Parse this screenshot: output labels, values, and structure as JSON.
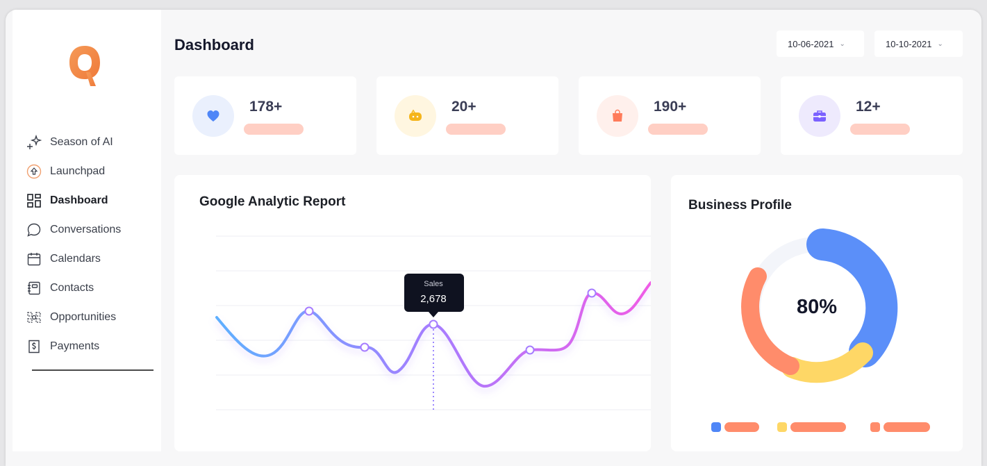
{
  "sidebar": {
    "items": [
      {
        "label": "Season of AI",
        "icon": "sparkles-icon",
        "active": false
      },
      {
        "label": "Launchpad",
        "icon": "rocket-icon",
        "active": false
      },
      {
        "label": "Dashboard",
        "icon": "grid-icon",
        "active": true
      },
      {
        "label": "Conversations",
        "icon": "chat-bubble-icon",
        "active": false
      },
      {
        "label": "Calendars",
        "icon": "calendar-icon",
        "active": false
      },
      {
        "label": "Contacts",
        "icon": "address-book-icon",
        "active": false
      },
      {
        "label": "Opportunities",
        "icon": "funnel-icon",
        "active": false
      },
      {
        "label": "Payments",
        "icon": "payment-icon",
        "active": false
      }
    ]
  },
  "header": {
    "title": "Dashboard",
    "date_start": "10-06-2021",
    "date_end": "10-10-2021"
  },
  "stats": [
    {
      "value": "178+",
      "icon": "heart-icon",
      "icon_color": "#4f86f7",
      "bg": "#eaf0fd"
    },
    {
      "value": "20+",
      "icon": "game-controller-icon",
      "icon_color": "#f5b51b",
      "bg": "#fff6e0"
    },
    {
      "value": "190+",
      "icon": "shopping-bag-icon",
      "icon_color": "#ff7b5a",
      "bg": "#fff0ec"
    },
    {
      "value": "12+",
      "icon": "briefcase-icon",
      "icon_color": "#7b61ff",
      "bg": "#eeeafd"
    }
  ],
  "analytics": {
    "title": "Google Analytic Report",
    "tooltip_label": "Sales",
    "tooltip_value": "2,678"
  },
  "chart_data": {
    "type": "line",
    "title": "Google Analytic Report",
    "xlabel": "",
    "ylabel": "",
    "grid": true,
    "legend": "none",
    "gradient": [
      "#5fb0ff",
      "#a67cff",
      "#f05ce6"
    ],
    "highlight_index": 3,
    "tooltip": {
      "label": "Sales",
      "value": "2,678"
    }
  },
  "profile": {
    "title": "Business Profile",
    "percent": "80%",
    "segments": [
      {
        "color": "#5b8ff9",
        "share": 0.4
      },
      {
        "color": "#fed766",
        "share": 0.22
      },
      {
        "color": "#ff8c6b",
        "share": 0.18
      },
      {
        "color": "#f3f5fa",
        "share": 0.2
      }
    ],
    "legend": [
      {
        "dot_color": "#4f86f7"
      },
      {
        "dot_color": "#fed766"
      },
      {
        "dot_color": "#ff8c6b"
      }
    ]
  }
}
